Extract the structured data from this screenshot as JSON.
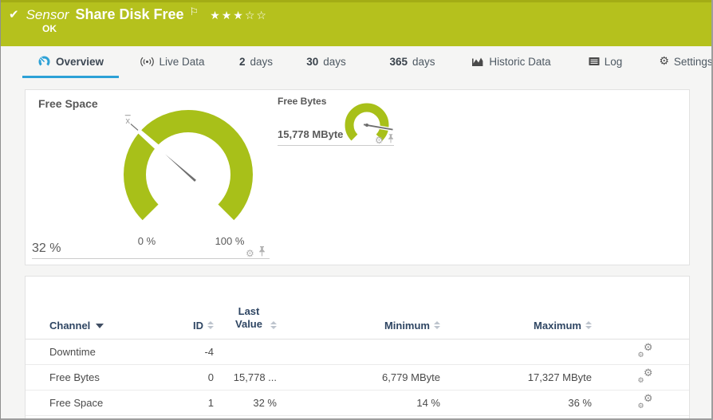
{
  "colors": {
    "header_green": "#b5c11d",
    "header_green_dark": "#a3ac15",
    "gauge_green": "#a8c019",
    "needle_gray": "#6e6e6e",
    "tab_active_blue": "#2da1d6",
    "table_header_navy": "#2f4663"
  },
  "header": {
    "check_icon": "✔",
    "kind": "Sensor",
    "title": "Share Disk Free",
    "flag_icon": "⚐",
    "rating_stars": "★★★☆☆",
    "status": "OK"
  },
  "tabs": {
    "items": [
      {
        "label": "Overview",
        "active": true
      },
      {
        "label": "Live Data"
      },
      {
        "number": "2",
        "label": "days"
      },
      {
        "number": "30",
        "label": "days"
      },
      {
        "number": "365",
        "label": "days"
      },
      {
        "label": "Historic Data"
      },
      {
        "label": "Log"
      },
      {
        "label": "Settings"
      }
    ]
  },
  "gauges": {
    "free_space": {
      "title": "Free Space",
      "value_label": "32 %",
      "min_label": "0 %",
      "max_label": "100 %",
      "mean_letter": "x"
    },
    "free_bytes": {
      "title": "Free Bytes",
      "value_label": "15,778 MByte"
    }
  },
  "chart_data": [
    {
      "type": "gauge",
      "title": "Free Space",
      "value": 32,
      "unit": "%",
      "min": 0,
      "max": 100,
      "value_label": "32 %",
      "min_label": "0 %",
      "max_label": "100 %",
      "sweep_degrees": 270,
      "mean_marker": "x̄"
    },
    {
      "type": "gauge",
      "title": "Free Bytes",
      "value_label": "15,778 MByte",
      "position_percent": 87,
      "sweep_degrees": 270
    }
  ],
  "channel_table": {
    "columns": [
      "Channel",
      "ID",
      "Last Value",
      "Minimum",
      "Maximum"
    ],
    "sorted_by": "Channel",
    "rows": [
      {
        "channel": "Downtime",
        "id": "-4",
        "last": "",
        "min": "",
        "max": ""
      },
      {
        "channel": "Free Bytes",
        "id": "0",
        "last": "15,778 ...",
        "min": "6,779 MByte",
        "max": "17,327 MByte"
      },
      {
        "channel": "Free Space",
        "id": "1",
        "last": "32 %",
        "min": "14 %",
        "max": "36 %"
      }
    ]
  }
}
